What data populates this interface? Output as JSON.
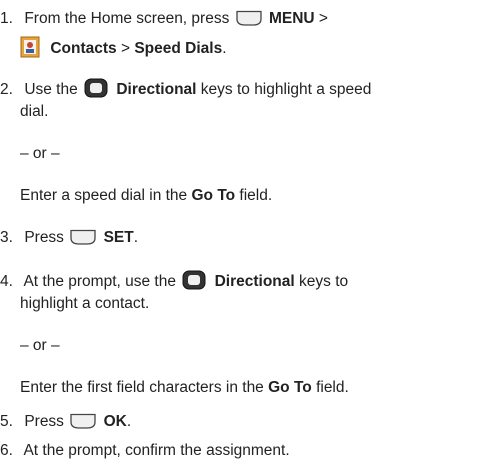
{
  "steps": {
    "s1": {
      "num": "1.",
      "a": "From the Home screen, press",
      "menu": "MENU",
      "gt1": ">",
      "contacts": "Contacts",
      "gt2": ">",
      "speed_dials": "Speed Dials",
      "end": "."
    },
    "s2": {
      "num": "2.",
      "a": "Use the",
      "directional": "Directional",
      "b1": "keys to highlight a speed",
      "b2": "dial.",
      "or": "– or –",
      "c": "Enter a speed dial in the",
      "goto": "Go To",
      "d": "field."
    },
    "s3": {
      "num": "3.",
      "a": "Press",
      "set": "SET",
      "end": "."
    },
    "s4": {
      "num": "4.",
      "a": "At the prompt, use the",
      "directional": "Directional",
      "b": "keys to",
      "c": "highlight a contact.",
      "or": "– or –",
      "d": "Enter the first field characters in the",
      "goto": "Go To",
      "e": "field."
    },
    "s5": {
      "num": "5.",
      "a": "Press",
      "ok": "OK",
      "end": "."
    },
    "s6": {
      "num": "6.",
      "a": "At the prompt, confirm the assignment."
    }
  },
  "icons": {
    "softkey": "softkey-icon",
    "directional": "directional-key-icon",
    "contacts": "contacts-icon"
  },
  "colors": {
    "text": "#222222",
    "key_fill": "#f0f0f0",
    "key_outline": "#444444"
  }
}
